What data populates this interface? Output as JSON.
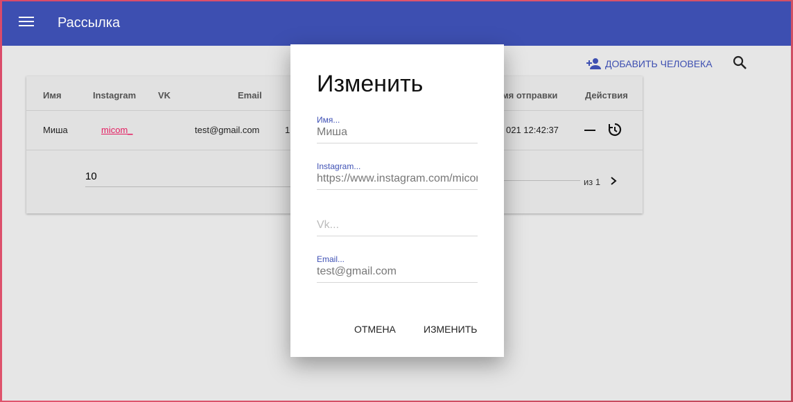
{
  "app": {
    "title": "Рассылка",
    "accent_color": "#3f51b5",
    "menu_icon": "menu-icon"
  },
  "toolbar": {
    "add_person_label": "ДОБАВИТЬ ЧЕЛОВЕКА",
    "add_person_icon": "person-add-icon",
    "search_icon": "search-icon"
  },
  "table": {
    "headers": [
      "Имя",
      "Instagram",
      "VK",
      "Email",
      "",
      "мя отправки",
      "Действия"
    ],
    "rows": [
      {
        "name": "Миша",
        "instagram": "micom_",
        "vk": "",
        "email": "test@gmail.com",
        "col5": "1",
        "send_time": "021 12:42:37"
      }
    ],
    "rows_per_page": "10",
    "page_info": "из 1"
  },
  "dialog": {
    "title": "Изменить",
    "fields": {
      "name": {
        "label": "Имя...",
        "value": "Миша"
      },
      "instagram": {
        "label": "Instagram...",
        "value": "https://www.instagram.com/micom_"
      },
      "vk": {
        "placeholder": "Vk..."
      },
      "email": {
        "label": "Email...",
        "value": "test@gmail.com"
      }
    },
    "cancel_label": "ОТМЕНА",
    "submit_label": "ИЗМЕНИТЬ"
  }
}
